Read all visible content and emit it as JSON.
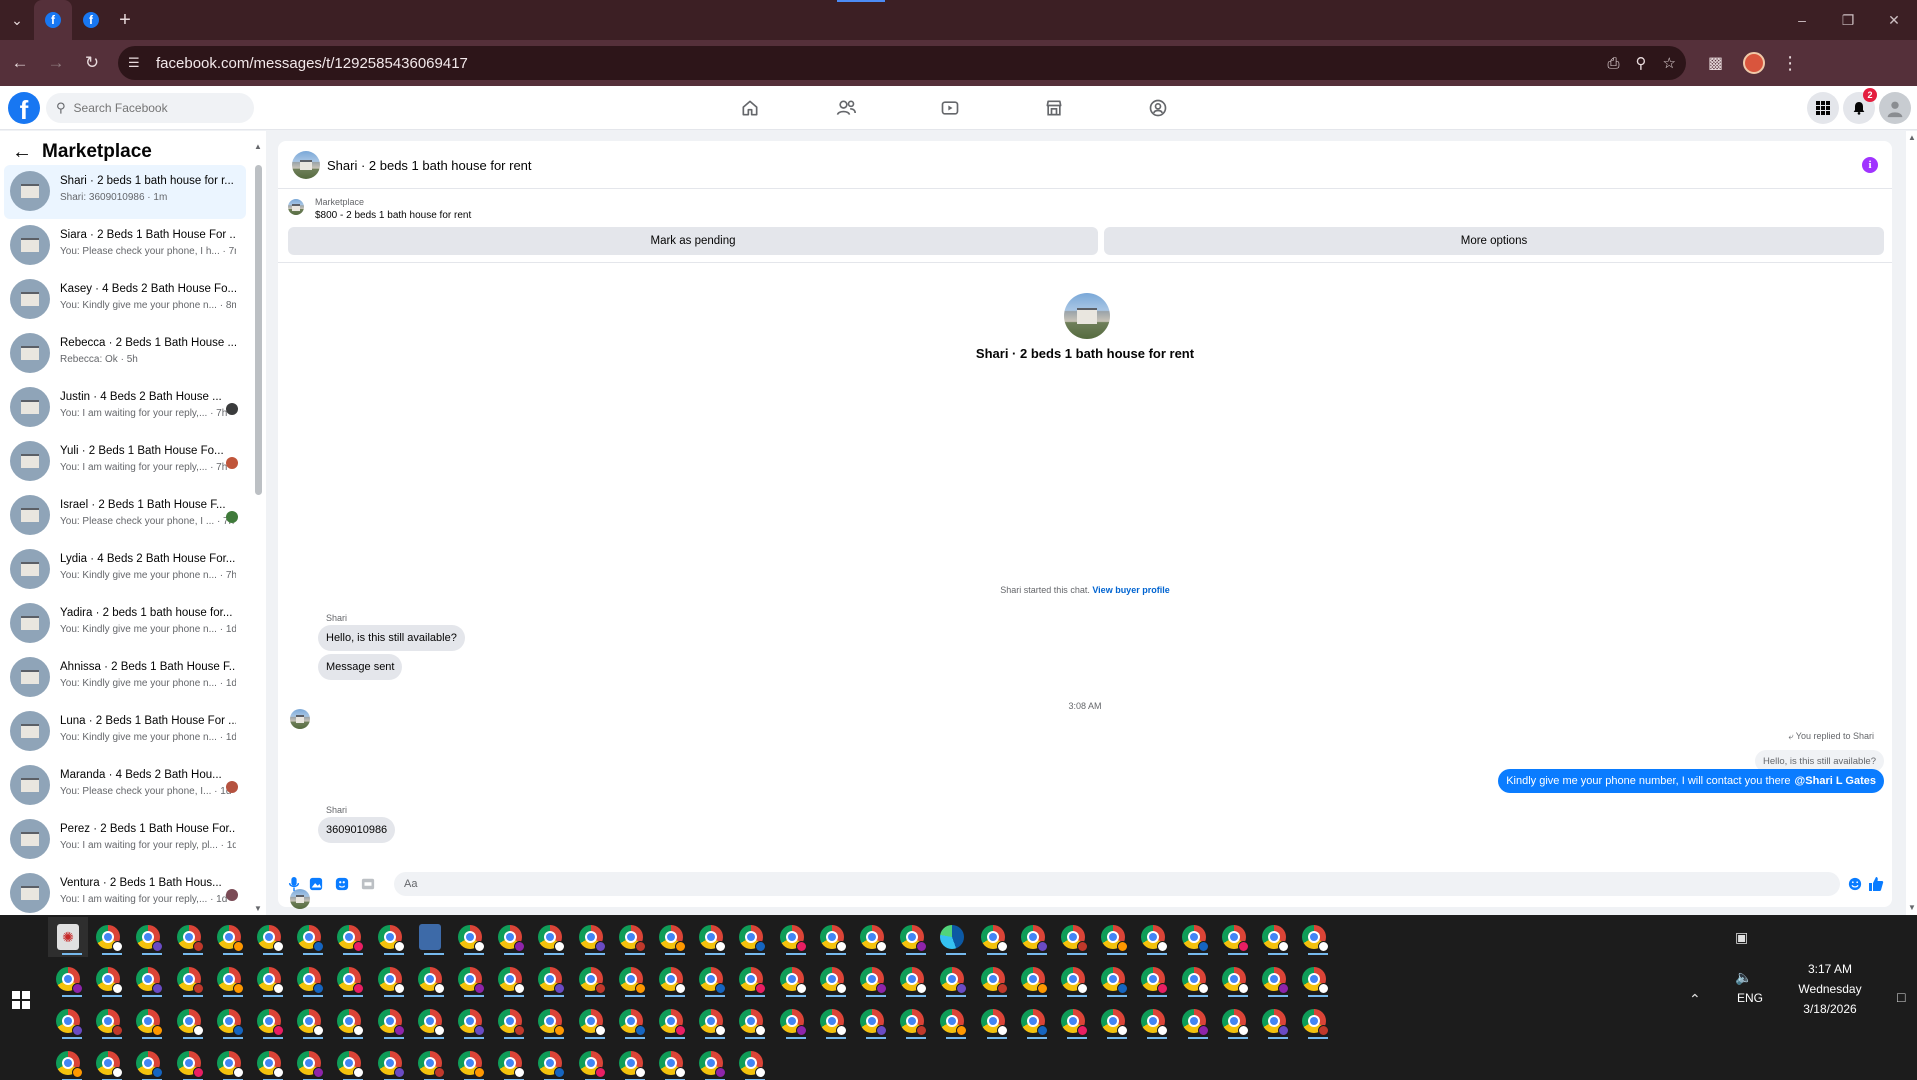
{
  "browser": {
    "url": "facebook.com/messages/t/1292585436069417",
    "tab_count": 2
  },
  "header": {
    "search_placeholder": "Search Facebook",
    "notification_count": "2",
    "nav_icons": [
      "home-icon",
      "friends-icon",
      "video-icon",
      "marketplace-icon",
      "groups-icon"
    ]
  },
  "sidebar": {
    "title": "Marketplace",
    "conversations": [
      {
        "title": "Shari · 2 beds 1 bath house for r...",
        "preview": "Shari: 3609010986 · 1m",
        "selected": true,
        "receipt": ""
      },
      {
        "title": "Siara · 2 Beds 1 Bath House For ...",
        "preview": "You: Please check your phone, I h... · 7m",
        "selected": false,
        "receipt": ""
      },
      {
        "title": "Kasey · 4 Beds 2 Bath House Fo...",
        "preview": "You: Kindly give me your phone n... · 8m",
        "selected": false,
        "receipt": ""
      },
      {
        "title": "Rebecca · 2 Beds 1 Bath House ...",
        "preview": "Rebecca: Ok · 5h",
        "selected": false,
        "receipt": ""
      },
      {
        "title": "Justin · 4 Beds 2 Bath House ...",
        "preview": "You: I am waiting for your reply,... · 7h",
        "selected": false,
        "receipt": "#3a3b3c"
      },
      {
        "title": "Yuli · 2 Beds 1 Bath House Fo...",
        "preview": "You: I am waiting for your reply,... · 7h",
        "selected": false,
        "receipt": "#c0553a"
      },
      {
        "title": "Israel · 2 Beds 1 Bath House F...",
        "preview": "You: Please check your phone, I ... · 7h",
        "selected": false,
        "receipt": "#3f7a3a"
      },
      {
        "title": "Lydia · 4 Beds 2 Bath House For...",
        "preview": "You: Kindly give me your phone n... · 7h",
        "selected": false,
        "receipt": ""
      },
      {
        "title": "Yadira · 2 beds 1 bath house for...",
        "preview": "You: Kindly give me your phone n... · 1d",
        "selected": false,
        "receipt": ""
      },
      {
        "title": "Ahnissa · 2 Beds 1 Bath House F...",
        "preview": "You: Kindly give me your phone n... · 1d",
        "selected": false,
        "receipt": ""
      },
      {
        "title": "Luna · 2 Beds 1 Bath House For ...",
        "preview": "You: Kindly give me your phone n... · 1d",
        "selected": false,
        "receipt": ""
      },
      {
        "title": "Maranda · 4 Beds 2 Bath Hou...",
        "preview": "You: Please check your phone, I... · 1d",
        "selected": false,
        "receipt": "#b5523f"
      },
      {
        "title": "Perez · 2 Beds 1 Bath House For...",
        "preview": "You: I am waiting for your reply, pl... · 1d",
        "selected": false,
        "receipt": ""
      },
      {
        "title": "Ventura · 2 Beds 1 Bath Hous...",
        "preview": "You: I am waiting for your reply,... · 1d",
        "selected": false,
        "receipt": "#7a4a55"
      }
    ]
  },
  "chat": {
    "title": "Shari · 2 beds 1 bath house for rent",
    "marketplace_label": "Marketplace",
    "listing": "$800 - 2 beds 1 bath house for rent",
    "mark_pending": "Mark as pending",
    "more_options": "More options",
    "center_title": "Shari · 2 beds 1 bath house for rent",
    "started_text": "Shari started this chat.",
    "view_profile": "View buyer profile",
    "sender_name_1": "Shari",
    "msg_in_1": "Hello, is this still available?",
    "msg_in_2": "Message sent",
    "time_divider": "3:08 AM",
    "replied_to": "You replied to Shari",
    "quoted_text": "Hello, is this still available?",
    "msg_out_text": "Kindly give me your phone number, I will contact you there",
    "msg_out_mention": "@Shari L Gates",
    "sender_name_2": "Shari",
    "msg_in_3": "3609010986",
    "composer_placeholder": "Aa"
  },
  "taskbar": {
    "time": "3:17 AM",
    "day": "Wednesday",
    "date": "3/18/2026",
    "language": "ENG"
  },
  "colors": {
    "fb_blue": "#1877f2",
    "bubble_out": "#0a7cff",
    "browser_frame": "#55303a",
    "selected_row": "#ebf5ff"
  }
}
